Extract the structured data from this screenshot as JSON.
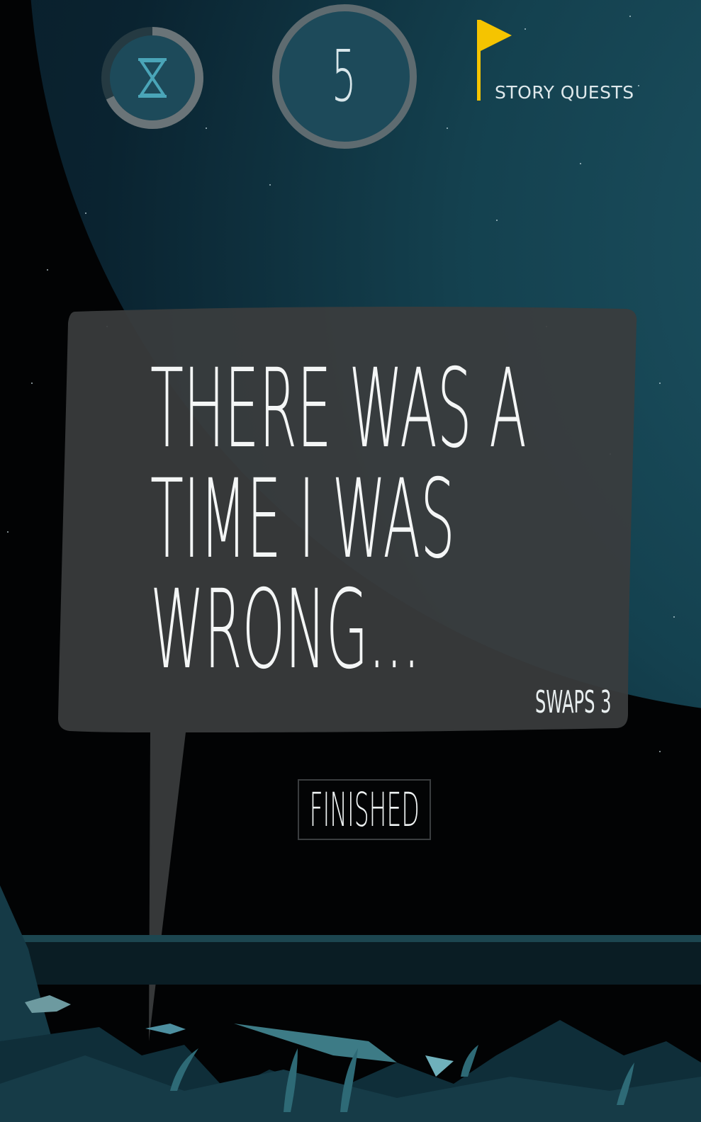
{
  "hud": {
    "timer_icon": "hourglass-icon",
    "timer_progress": 0.68,
    "moves_value": "5",
    "quests_label": "STORY QUESTS",
    "quests_icon": "flag-icon"
  },
  "speech": {
    "lines": [
      "THERE WAS A",
      "TIME I WAS",
      "WRONG..."
    ],
    "swaps_label": "SWAPS 3"
  },
  "actions": {
    "finished_label": "FINISHED"
  },
  "colors": {
    "bubble": "#3a3c3d",
    "flag": "#f5c400",
    "planet": "#1c4b5b",
    "seabed": "#123c4a"
  }
}
